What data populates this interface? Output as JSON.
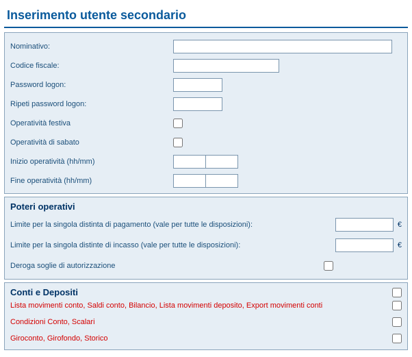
{
  "title": "Inserimento utente secondario",
  "form": {
    "nominativo": {
      "label": "Nominativo:",
      "value": ""
    },
    "codice_fiscale": {
      "label": "Codice fiscale:",
      "value": ""
    },
    "password": {
      "label": "Password logon:",
      "value": ""
    },
    "password2": {
      "label": "Ripeti password logon:",
      "value": ""
    },
    "op_festiva": {
      "label": "Operatività festiva"
    },
    "op_sabato": {
      "label": "Operatività di sabato"
    },
    "inizio_op": {
      "label": "Inizio operatività (hh/mm)",
      "hh": "",
      "mm": ""
    },
    "fine_op": {
      "label": "Fine operatività (hh/mm)",
      "hh": "",
      "mm": ""
    }
  },
  "powers": {
    "heading": "Poteri operativi",
    "pay_limit": {
      "label": "Limite per la singola distinta di pagamento (vale per tutte le disposizioni):",
      "value": "",
      "currency": "€"
    },
    "coll_limit": {
      "label": "Limite per la singola distinte di incasso (vale per tutte le disposizioni):",
      "value": "",
      "currency": "€"
    },
    "deroga": {
      "label": "Deroga soglie di autorizzazione"
    }
  },
  "accounts": {
    "heading": "Conti e Depositi",
    "rows": [
      {
        "items": [
          "Lista movimenti conto",
          "Saldi conto",
          "Bilancio",
          "Lista movimenti deposito",
          "Export movimenti conti"
        ]
      },
      {
        "items": [
          "Condizioni Conto",
          "Scalari"
        ]
      },
      {
        "items": [
          "Giroconto",
          "Girofondo",
          "Storico"
        ]
      }
    ]
  }
}
